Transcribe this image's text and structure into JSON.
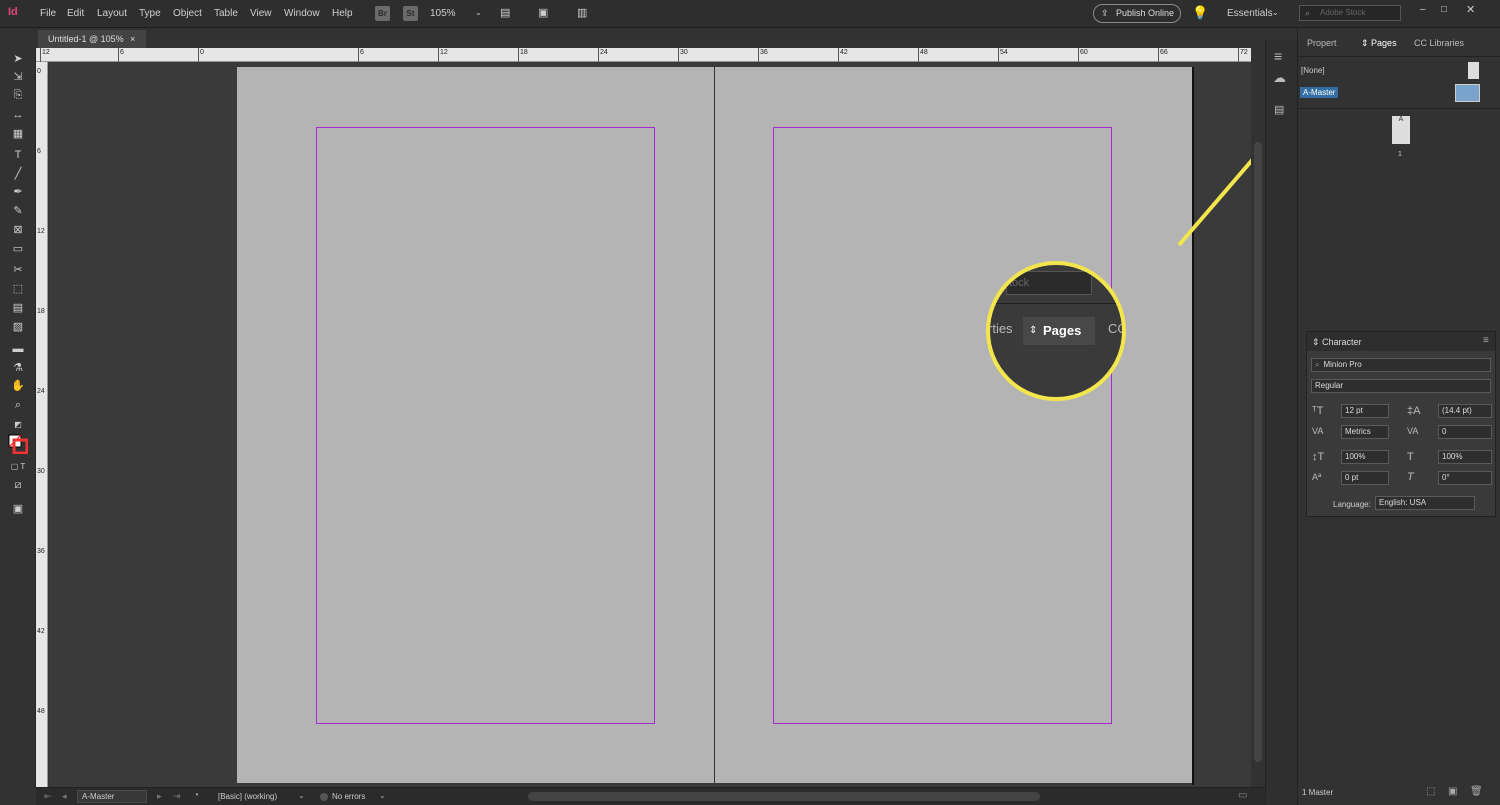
{
  "menubar": {
    "app_icon": "Id",
    "items": [
      "File",
      "Edit",
      "Layout",
      "Type",
      "Object",
      "Table",
      "View",
      "Window",
      "Help"
    ],
    "br_label": "Br",
    "st_label": "St",
    "zoom": "105%",
    "publish_label": "Publish Online",
    "workspace": "Essentials",
    "stock_placeholder": "Adobe Stock"
  },
  "document_tab": {
    "label": "Untitled-1 @ 105%",
    "close": "×"
  },
  "ruler": {
    "h_labels": [
      "12",
      "6",
      "0",
      "6",
      "12",
      "18",
      "24",
      "30",
      "36",
      "42",
      "48",
      "54",
      "60",
      "66",
      "72"
    ],
    "v_labels": [
      "0",
      "6",
      "1 2",
      "1 8",
      "2 4",
      "3 0",
      "3 6",
      "4 2",
      "4 8"
    ]
  },
  "status": {
    "page": "A-Master",
    "preflight_profile": "[Basic] (working)",
    "errors": "No errors"
  },
  "panel": {
    "tabs": [
      "Properties",
      "Pages",
      "CC Libraries"
    ],
    "none_label": "[None]",
    "master_label": "A-Master",
    "page_thumb_letter": "A",
    "page_number": "1",
    "footer": "1 Master"
  },
  "callout": {
    "stock_fragment": "tock",
    "tab_left": "rties",
    "tab_active": "Pages",
    "tab_right": "CC",
    "color": "#f3e64d"
  },
  "character": {
    "title": "Character",
    "font_family": "Minion Pro",
    "font_style": "Regular",
    "size": "12 pt",
    "leading": "(14.4 pt)",
    "kerning": "Metrics",
    "tracking": "0",
    "vscale": "100%",
    "hscale": "100%",
    "baseline": "0 pt",
    "skew": "0°",
    "language_label": "Language:",
    "language": "English: USA"
  }
}
